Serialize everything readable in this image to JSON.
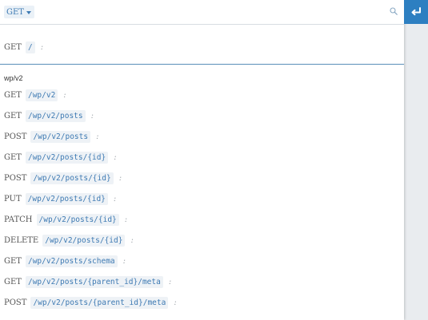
{
  "method_select": {
    "label": "GET"
  },
  "root_route": {
    "method": "GET",
    "path": "/",
    "sep": ":"
  },
  "group": {
    "label": "wp/v2"
  },
  "routes": [
    {
      "method": "GET",
      "path": "/wp/v2",
      "sep": ":"
    },
    {
      "method": "GET",
      "path": "/wp/v2/posts",
      "sep": ":"
    },
    {
      "method": "POST",
      "path": "/wp/v2/posts",
      "sep": ":"
    },
    {
      "method": "GET",
      "path": "/wp/v2/posts/{id}",
      "sep": ":"
    },
    {
      "method": "POST",
      "path": "/wp/v2/posts/{id}",
      "sep": ":"
    },
    {
      "method": "PUT",
      "path": "/wp/v2/posts/{id}",
      "sep": ":"
    },
    {
      "method": "PATCH",
      "path": "/wp/v2/posts/{id}",
      "sep": ":"
    },
    {
      "method": "DELETE",
      "path": "/wp/v2/posts/{id}",
      "sep": ":"
    },
    {
      "method": "GET",
      "path": "/wp/v2/posts/schema",
      "sep": ":"
    },
    {
      "method": "GET",
      "path": "/wp/v2/posts/{parent_id}/meta",
      "sep": ":"
    },
    {
      "method": "POST",
      "path": "/wp/v2/posts/{parent_id}/meta",
      "sep": ":"
    }
  ],
  "icons": {
    "search": "search-icon",
    "enter": "enter-icon",
    "dropdown": "chevron-down-icon"
  },
  "colors": {
    "accent": "#2d7fc1",
    "path_text": "#3e7ab3",
    "divider": "#5b8fb9"
  }
}
